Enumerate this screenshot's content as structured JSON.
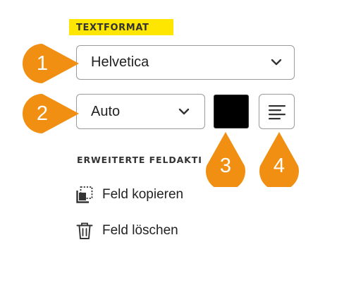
{
  "text_format": {
    "section_title": "TEXTFORMAT",
    "font_select": {
      "value": "Helvetica"
    },
    "size_select": {
      "value": "Auto"
    },
    "color_swatch": {
      "color": "#000000"
    },
    "align_button": {
      "icon": "align-left-icon"
    }
  },
  "advanced_actions": {
    "section_title": "ERWEITERTE FELDAKTI",
    "items": [
      {
        "label": "Feld kopieren",
        "icon": "copy-field-icon"
      },
      {
        "label": "Feld löschen",
        "icon": "trash-icon"
      }
    ]
  },
  "callouts": [
    "1",
    "2",
    "3",
    "4"
  ],
  "colors": {
    "accent": "#ffe600",
    "callout": "#f18f12"
  }
}
